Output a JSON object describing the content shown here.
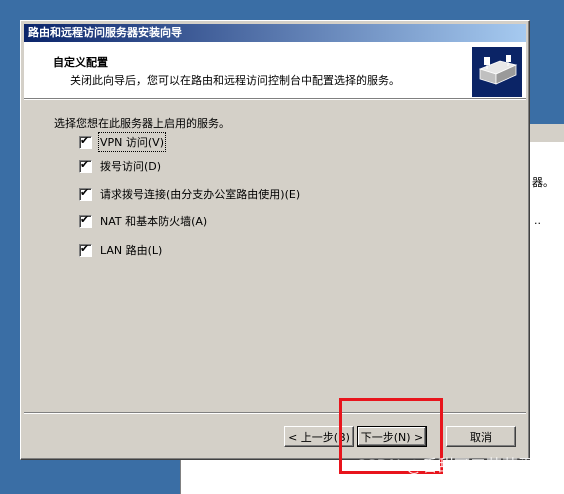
{
  "dialog": {
    "title": "路由和远程访问服务器安装向导",
    "header_title": "自定义配置",
    "header_desc": "关闭此向导后，您可以在路由和远程访问控制台中配置选择的服务。"
  },
  "prompt": "选择您想在此服务器上启用的服务。",
  "services": [
    {
      "label": "VPN 访问(V)",
      "checked": true
    },
    {
      "label": "拨号访问(D)",
      "checked": true
    },
    {
      "label": "请求拨号连接(由分支办公室路由使用)(E)",
      "checked": true
    },
    {
      "label": "NAT 和基本防火墙(A)",
      "checked": true
    },
    {
      "label": "LAN 路由(L)",
      "checked": true
    }
  ],
  "buttons": {
    "back": "< 上一步(B)",
    "next": "下一步(N) >",
    "cancel": "取消"
  },
  "background_window": {
    "frag1": "器。",
    "frag2": ".."
  },
  "watermark": "CSDN @香甜可口草莓蛋糕",
  "colors": {
    "desktop": "#3a6ea5",
    "title_gradient_start": "#0a246a",
    "highlight_box": "#e8141c"
  },
  "icons": {
    "header_icon": "router-wizard-icon",
    "check": "checkmark-icon"
  }
}
